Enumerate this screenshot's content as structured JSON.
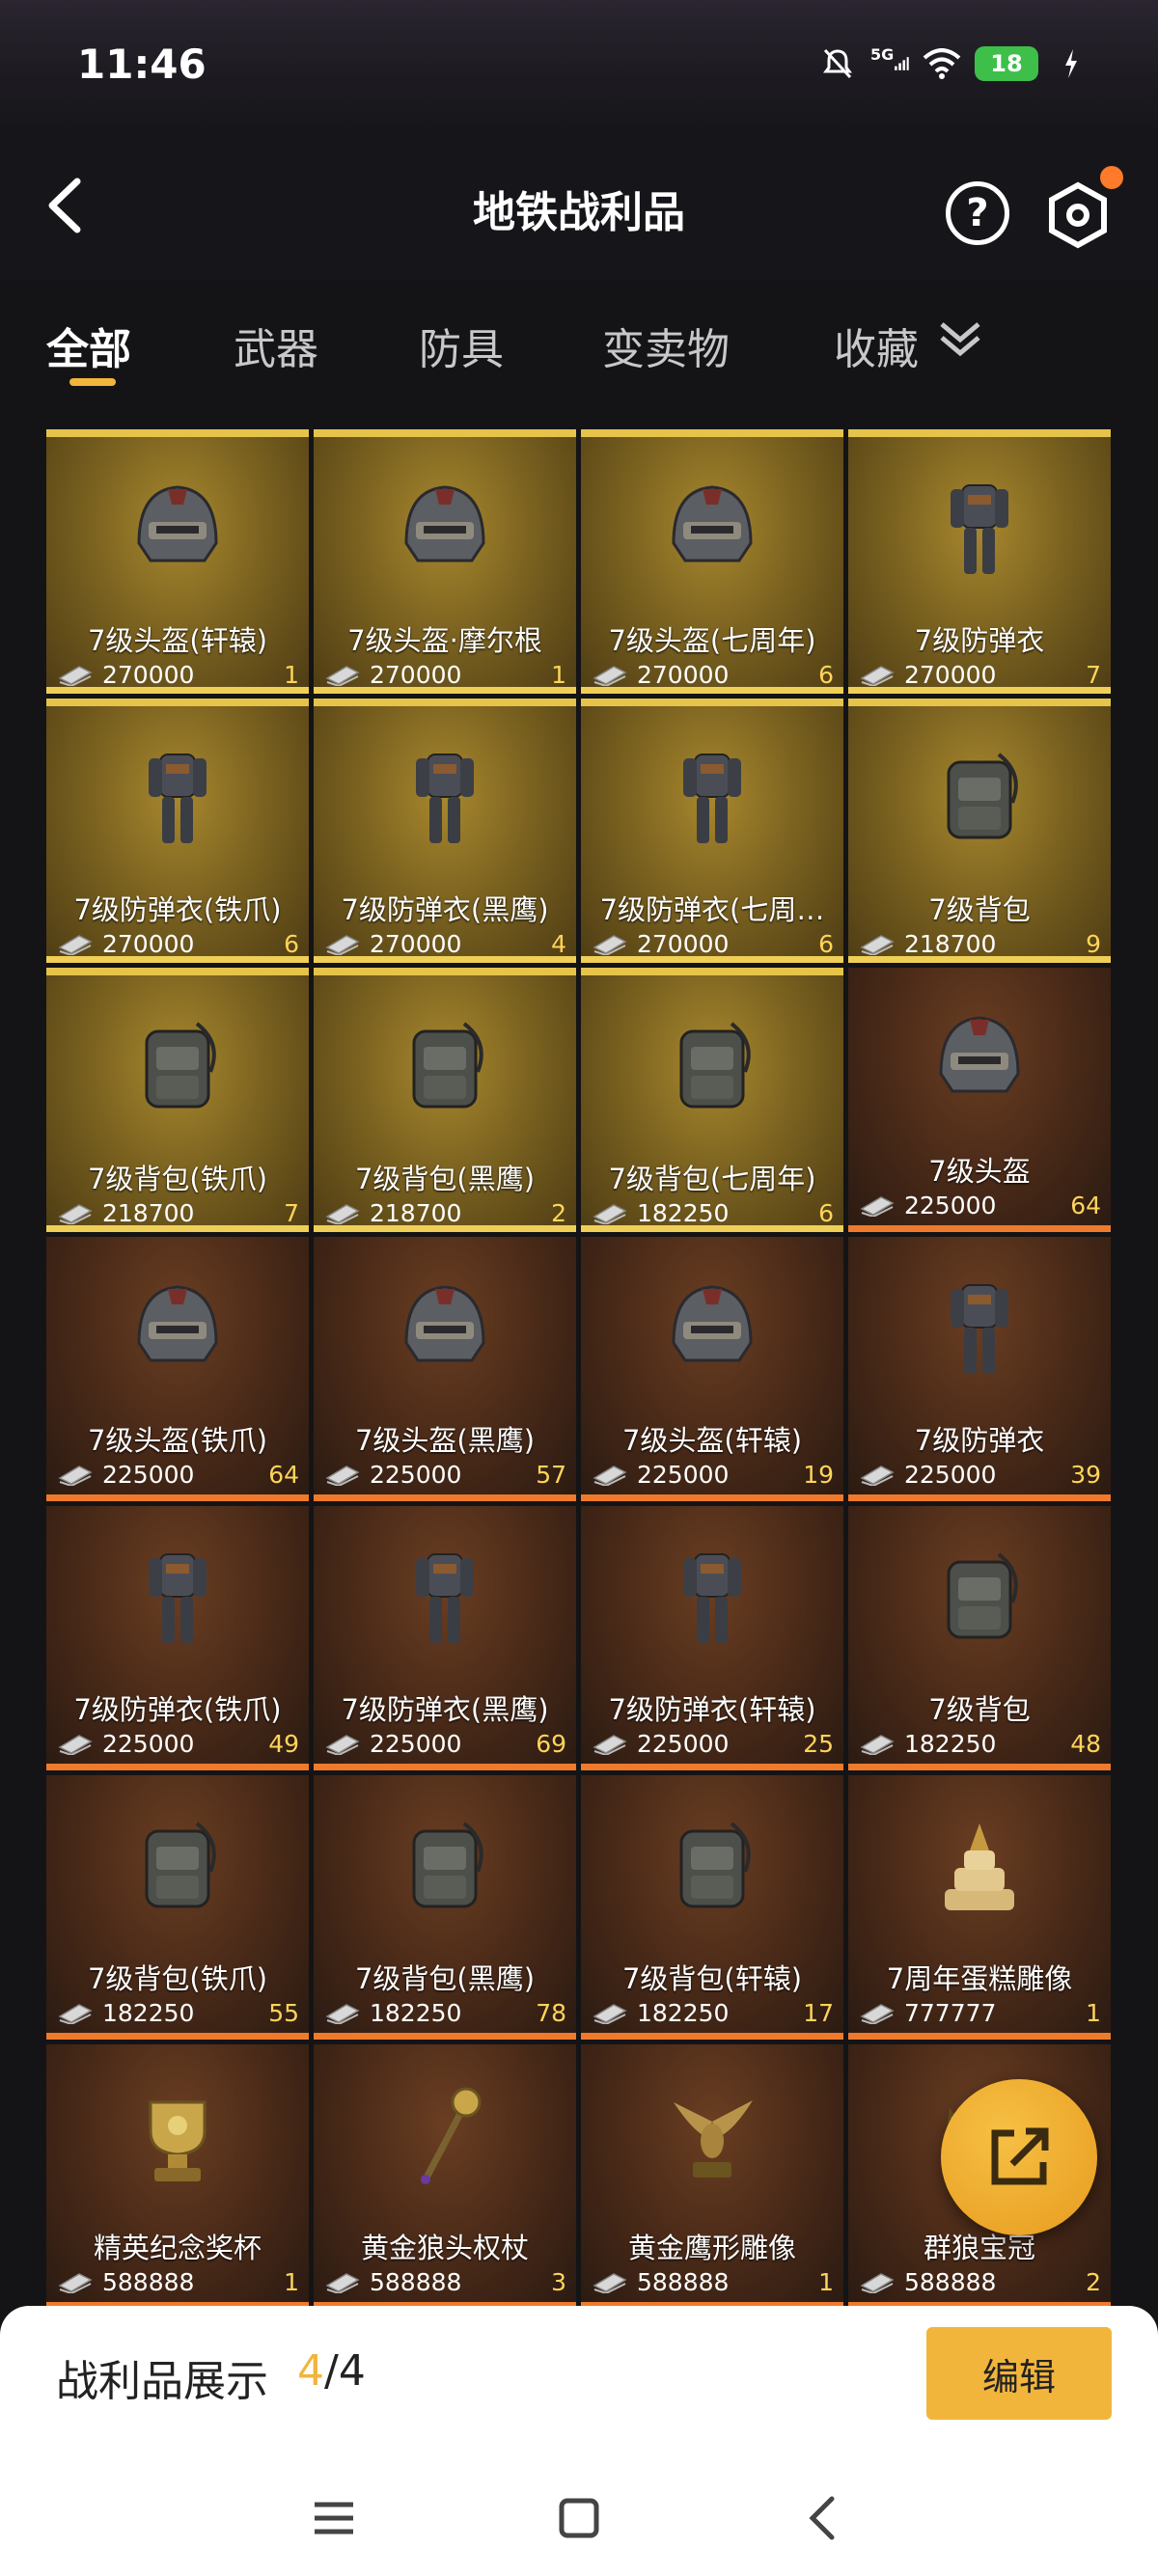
{
  "status_bar": {
    "time": "11:46",
    "network": "5G",
    "battery": "18",
    "icons": [
      "mute-bell-icon",
      "signal-icon",
      "wifi-icon",
      "battery-icon",
      "charging-icon"
    ]
  },
  "header": {
    "title": "地铁战利品",
    "help": "?"
  },
  "tabs": [
    {
      "label": "全部",
      "active": true
    },
    {
      "label": "武器",
      "active": false
    },
    {
      "label": "防具",
      "active": false
    },
    {
      "label": "变卖物",
      "active": false
    },
    {
      "label": "收藏",
      "active": false
    }
  ],
  "items": [
    {
      "name": "7级头盔(轩辕)",
      "price": "270000",
      "count": "1",
      "tier": "gold",
      "icon": "helmet"
    },
    {
      "name": "7级头盔·摩尔根",
      "price": "270000",
      "count": "1",
      "tier": "gold",
      "icon": "helmet"
    },
    {
      "name": "7级头盔(七周年)",
      "price": "270000",
      "count": "6",
      "tier": "gold",
      "icon": "helmet"
    },
    {
      "name": "7级防弹衣",
      "price": "270000",
      "count": "7",
      "tier": "gold",
      "icon": "armor"
    },
    {
      "name": "7级防弹衣(铁爪)",
      "price": "270000",
      "count": "6",
      "tier": "gold",
      "icon": "armor"
    },
    {
      "name": "7级防弹衣(黑鹰)",
      "price": "270000",
      "count": "4",
      "tier": "gold",
      "icon": "armor"
    },
    {
      "name": "7级防弹衣(七周…",
      "price": "270000",
      "count": "6",
      "tier": "gold",
      "icon": "armor"
    },
    {
      "name": "7级背包",
      "price": "218700",
      "count": "9",
      "tier": "gold",
      "icon": "backpack"
    },
    {
      "name": "7级背包(铁爪)",
      "price": "218700",
      "count": "7",
      "tier": "gold",
      "icon": "backpack"
    },
    {
      "name": "7级背包(黑鹰)",
      "price": "218700",
      "count": "2",
      "tier": "gold",
      "icon": "backpack"
    },
    {
      "name": "7级背包(七周年)",
      "price": "182250",
      "count": "6",
      "tier": "gold",
      "icon": "backpack"
    },
    {
      "name": "7级头盔",
      "price": "225000",
      "count": "64",
      "tier": "bronze",
      "icon": "helmet"
    },
    {
      "name": "7级头盔(铁爪)",
      "price": "225000",
      "count": "64",
      "tier": "bronze",
      "icon": "helmet"
    },
    {
      "name": "7级头盔(黑鹰)",
      "price": "225000",
      "count": "57",
      "tier": "bronze",
      "icon": "helmet"
    },
    {
      "name": "7级头盔(轩辕)",
      "price": "225000",
      "count": "19",
      "tier": "bronze",
      "icon": "helmet"
    },
    {
      "name": "7级防弹衣",
      "price": "225000",
      "count": "39",
      "tier": "bronze",
      "icon": "armor"
    },
    {
      "name": "7级防弹衣(铁爪)",
      "price": "225000",
      "count": "49",
      "tier": "bronze",
      "icon": "armor"
    },
    {
      "name": "7级防弹衣(黑鹰)",
      "price": "225000",
      "count": "69",
      "tier": "bronze",
      "icon": "armor"
    },
    {
      "name": "7级防弹衣(轩辕)",
      "price": "225000",
      "count": "25",
      "tier": "bronze",
      "icon": "armor"
    },
    {
      "name": "7级背包",
      "price": "182250",
      "count": "48",
      "tier": "bronze",
      "icon": "backpack"
    },
    {
      "name": "7级背包(铁爪)",
      "price": "182250",
      "count": "55",
      "tier": "bronze",
      "icon": "backpack"
    },
    {
      "name": "7级背包(黑鹰)",
      "price": "182250",
      "count": "78",
      "tier": "bronze",
      "icon": "backpack"
    },
    {
      "name": "7级背包(轩辕)",
      "price": "182250",
      "count": "17",
      "tier": "bronze",
      "icon": "backpack"
    },
    {
      "name": "7周年蛋糕雕像",
      "price": "777777",
      "count": "1",
      "tier": "bronze",
      "icon": "cake-statue"
    },
    {
      "name": "精英纪念奖杯",
      "price": "588888",
      "count": "1",
      "tier": "bronze",
      "icon": "trophy"
    },
    {
      "name": "黄金狼头权杖",
      "price": "588888",
      "count": "3",
      "tier": "bronze",
      "icon": "scepter"
    },
    {
      "name": "黄金鹰形雕像",
      "price": "588888",
      "count": "1",
      "tier": "bronze",
      "icon": "eagle-statue"
    },
    {
      "name": "群狼宝冠",
      "price": "588888",
      "count": "2",
      "tier": "bronze",
      "icon": "crown"
    }
  ],
  "bottom": {
    "label": "战利品展示",
    "current": "4",
    "total": "/4",
    "edit_label": "编辑"
  },
  "colors": {
    "accent": "#f2b53c",
    "gold_card": "#7c6320",
    "bronze_card": "#4a2a18",
    "count_text": "#ffd45a"
  }
}
